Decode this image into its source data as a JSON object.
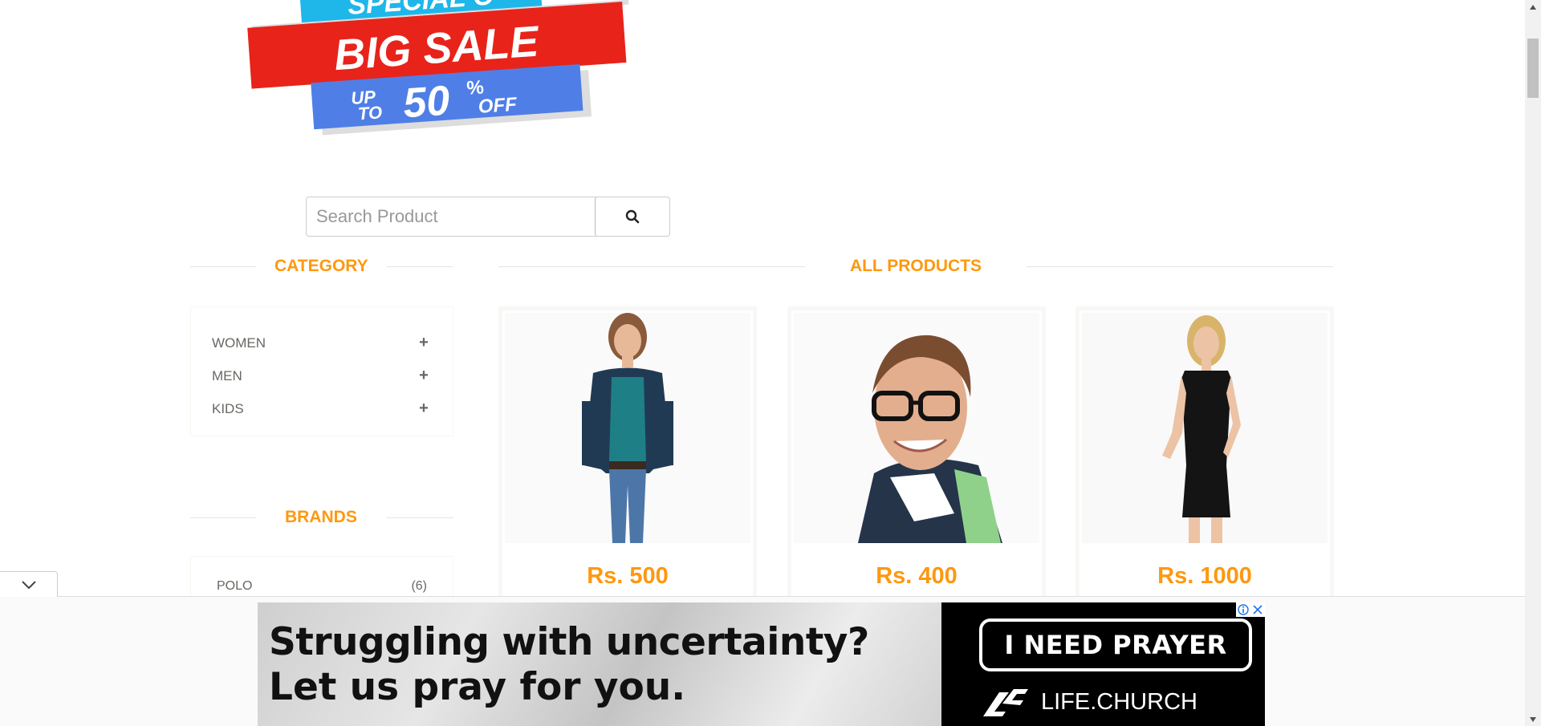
{
  "banner": {
    "line_top": "SPECIAL O",
    "line_main": "BIG SALE",
    "line_upto_1": "UP",
    "line_upto_2": "TO",
    "line_pct": "50",
    "line_pct_sign": "%",
    "line_off": "OFF"
  },
  "search": {
    "placeholder": "Search Product",
    "button_icon": "search-icon"
  },
  "sections": {
    "category_title": "CATEGORY",
    "products_title": "ALL PRODUCTS",
    "brands_title": "BRANDS"
  },
  "categories": [
    {
      "label": "WOMEN",
      "icon": "plus-icon"
    },
    {
      "label": "MEN",
      "icon": "plus-icon"
    },
    {
      "label": "KIDS",
      "icon": "plus-icon"
    }
  ],
  "brands": [
    {
      "label": "POLO",
      "count": "(6)"
    }
  ],
  "products": [
    {
      "price": "Rs. 500",
      "image": "woman-cardigan-photo"
    },
    {
      "price": "Rs. 400",
      "image": "man-glasses-photo"
    },
    {
      "price": "Rs. 1000",
      "image": "woman-black-dress-photo"
    }
  ],
  "ad": {
    "headline": "Struggling with uncertainty?",
    "subline": "Let us pray for you.",
    "cta": "I NEED PRAYER",
    "brand": "LIFE.CHURCH",
    "info_icon": "info-icon",
    "close_icon": "close-icon"
  },
  "colors": {
    "accent": "#fe980f",
    "banner_red": "#e8231a",
    "banner_blue": "#4f7fe6",
    "banner_cyan": "#1fb6ea"
  }
}
